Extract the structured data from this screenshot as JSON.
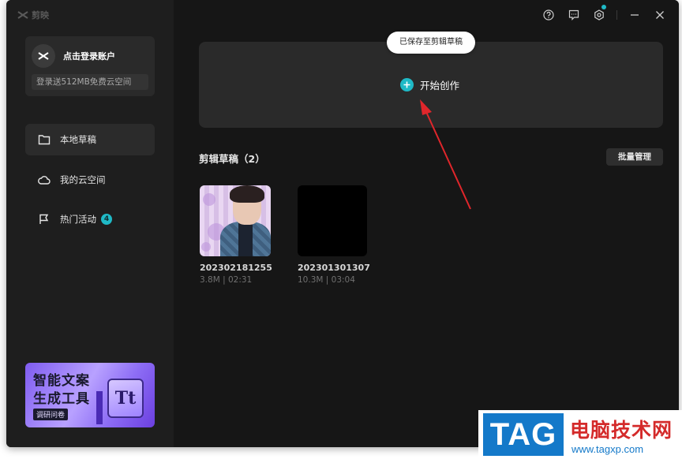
{
  "app": {
    "brand_name": "剪映"
  },
  "account": {
    "login_label": "点击登录账户",
    "cloud_promo": "登录送512MB免费云空间"
  },
  "nav": {
    "local_drafts": "本地草稿",
    "my_cloud": "我的云空间",
    "hot_events": "热门活动",
    "hot_events_badge": "4"
  },
  "promo": {
    "line1": "智能文案",
    "line2": "生成工具",
    "tag": "调研问卷",
    "tt": "Tt"
  },
  "main": {
    "toast": "已保存至剪辑草稿",
    "create_label": "开始创作",
    "drafts_title": "剪辑草稿（2）",
    "batch_manage": "批量管理"
  },
  "drafts": [
    {
      "name": "202302181255",
      "meta": "3.8M | 02:31"
    },
    {
      "name": "202301301307",
      "meta": "10.3M | 03:04"
    }
  ],
  "watermark": {
    "tag": "TAG",
    "site_name": "电脑技术网",
    "url": "www.tagxp.com"
  },
  "colors": {
    "accent": "#1fb9c6",
    "arrow": "#e0262b",
    "background": "#161616",
    "sidebar": "#1e1e1e"
  }
}
